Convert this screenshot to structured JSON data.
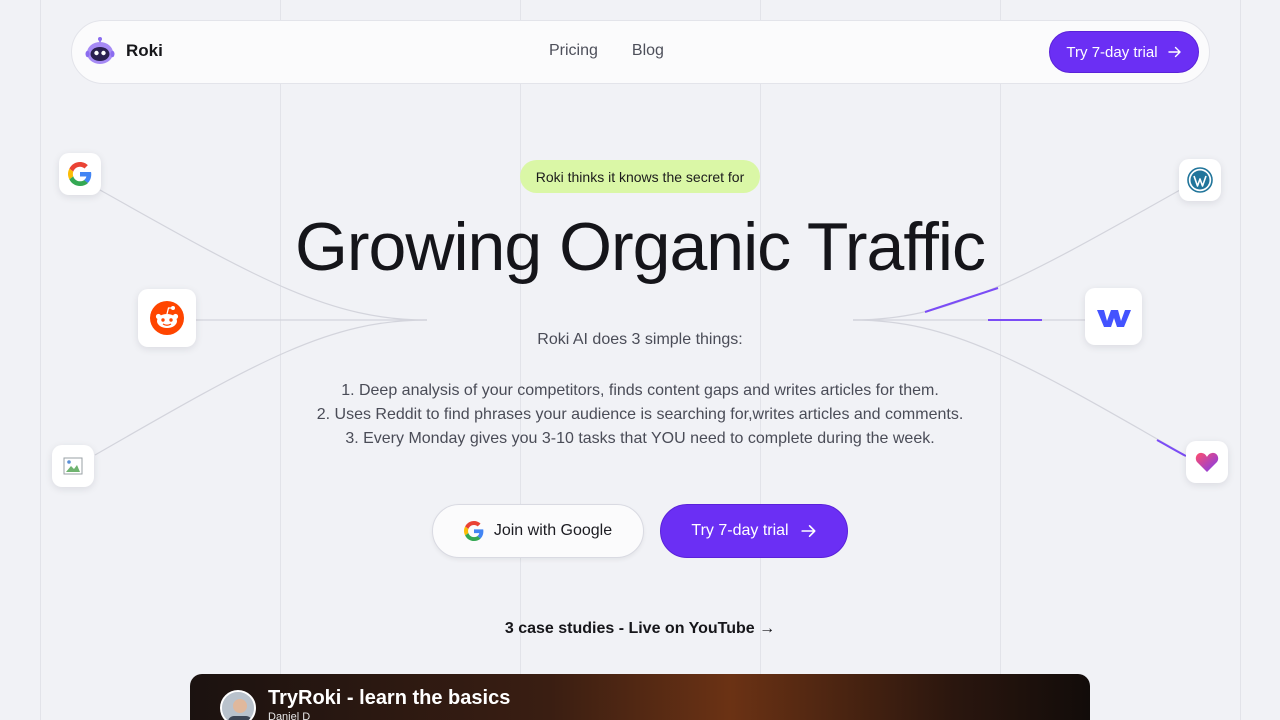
{
  "brand": {
    "name": "Roki"
  },
  "nav": {
    "links": [
      "Pricing",
      "Blog"
    ],
    "cta_label": "Try 7-day trial"
  },
  "hero": {
    "badge": "Roki thinks it knows the secret for",
    "title": "Growing Organic Traffic",
    "intro": "Roki AI does 3 simple things:",
    "steps": [
      "1. Deep analysis of your competitors, finds content gaps and writes articles for them.",
      "2. Uses Reddit to find phrases your audience is searching for,writes articles and comments.",
      "3. Every Monday gives you 3-10 tasks that YOU need to complete during the week."
    ],
    "google_button": "Join with Google",
    "trial_button": "Try 7-day trial",
    "case_link": "3 case studies - Live on YouTube →"
  },
  "video": {
    "title": "TryRoki - learn the basics",
    "author": "Daniel D"
  },
  "icons": {
    "left": [
      "google-icon",
      "reddit-icon",
      "broken-image-icon"
    ],
    "right": [
      "wordpress-icon",
      "webflow-icon",
      "heart-app-icon"
    ]
  },
  "colors": {
    "accent": "#6b2ff4",
    "badge_bg": "#daf7a6",
    "page_bg": "#f1f2f6"
  }
}
